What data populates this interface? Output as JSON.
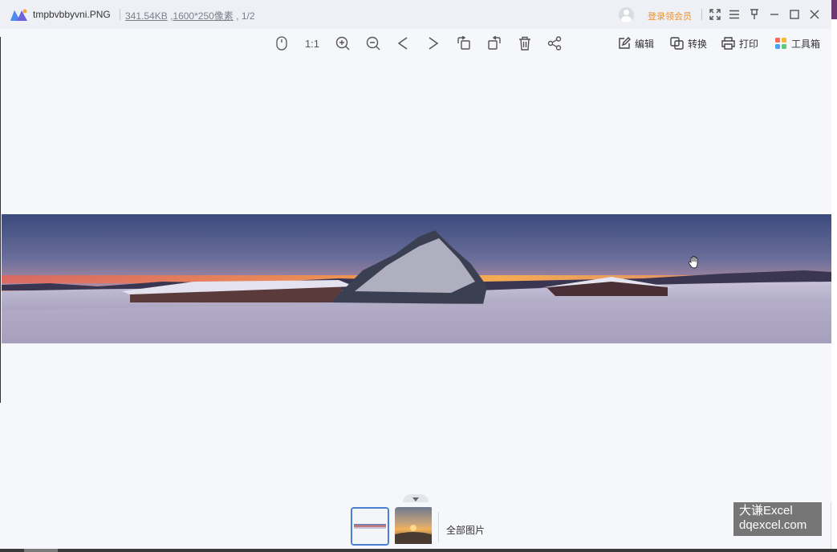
{
  "titlebar": {
    "file_name": "tmpbvbbyvni.PNG",
    "file_size": "341.54KB",
    "dimensions": "1600*250像素",
    "page_index": "1/2",
    "login_label": "登录领会员",
    "icons": [
      "app-logo",
      "user-avatar",
      "fullscreen-icon",
      "menu-icon",
      "pin-icon",
      "minimize-icon",
      "maximize-icon",
      "close-icon"
    ]
  },
  "toolbar": {
    "actual_size_label": "1:1",
    "edit_label": "编辑",
    "convert_label": "转换",
    "print_label": "打印",
    "toolbox_label": "工具箱",
    "icons": [
      "mouse-icon",
      "zoom-in-icon",
      "zoom-out-icon",
      "previous-icon",
      "next-icon",
      "rotate-left-icon",
      "rotate-right-icon",
      "delete-icon",
      "share-icon"
    ]
  },
  "thumbnails": {
    "all_images_label": "全部图片",
    "count": 2,
    "active_index": 0
  },
  "watermark": {
    "line1": "大谦Excel",
    "line2": "dqexcel.com"
  },
  "colors": {
    "accent": "#4a7fd6",
    "vip": "#f0902a",
    "background": "#f6f7fb"
  }
}
